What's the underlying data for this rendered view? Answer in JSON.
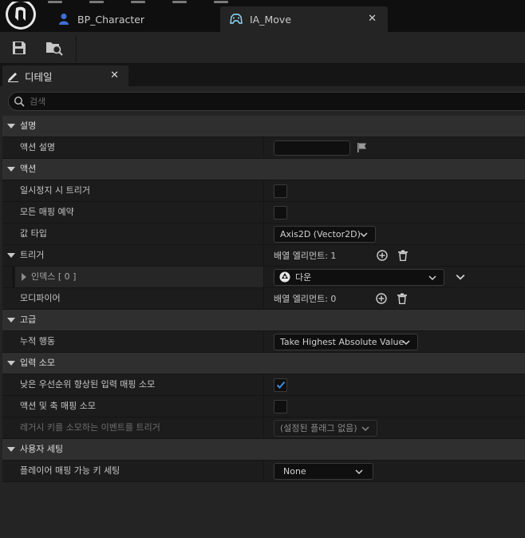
{
  "tabs": [
    {
      "label": "BP_Character",
      "icon": "person-icon"
    },
    {
      "label": "IA_Move",
      "icon": "gamepad-icon"
    }
  ],
  "details_panel": {
    "title": "디테일",
    "search_placeholder": "검색"
  },
  "sections": {
    "description": {
      "title": "설명",
      "action_description_label": "액션 설명"
    },
    "action": {
      "title": "액션",
      "trigger_when_paused_label": "일시정지 시 트리거",
      "reserve_all_mappings_label": "모든 매핑 예약",
      "value_type_label": "값 타입",
      "value_type_value": "Axis2D (Vector2D)",
      "triggers_label": "트리거",
      "triggers_array_text": "배열 엘리먼트: 1",
      "index_label": "인덱스 [ 0 ]",
      "index_value": "다운",
      "modifiers_label": "모디파이어",
      "modifiers_array_text": "배열 엘리먼트: 0"
    },
    "advanced": {
      "title": "고급",
      "accumulation_label": "누적 행동",
      "accumulation_value": "Take Highest Absolute Value"
    },
    "input_consumption": {
      "title": "입력 소모",
      "consume_lower_priority_label": "낮은 우선순위 향상된 입력 매핑 소모",
      "consume_lower_priority_checked": true,
      "consume_action_axis_label": "액션 및 축 매핑 소모",
      "consume_action_axis_checked": false,
      "legacy_keys_label": "레거시 키를 소모하는 이벤트를 트리거",
      "legacy_keys_value": "(설정된 플래그 없음)"
    },
    "user_settings": {
      "title": "사용자 세팅",
      "player_mappable_label": "플레이어 매핑 가능 키 세팅",
      "player_mappable_value": "None"
    }
  },
  "colors": {
    "accent": "#3d8fd9",
    "panel_bg": "#242424",
    "row_bg": "#1c1c1c",
    "category_bg": "#2f2f2f"
  }
}
